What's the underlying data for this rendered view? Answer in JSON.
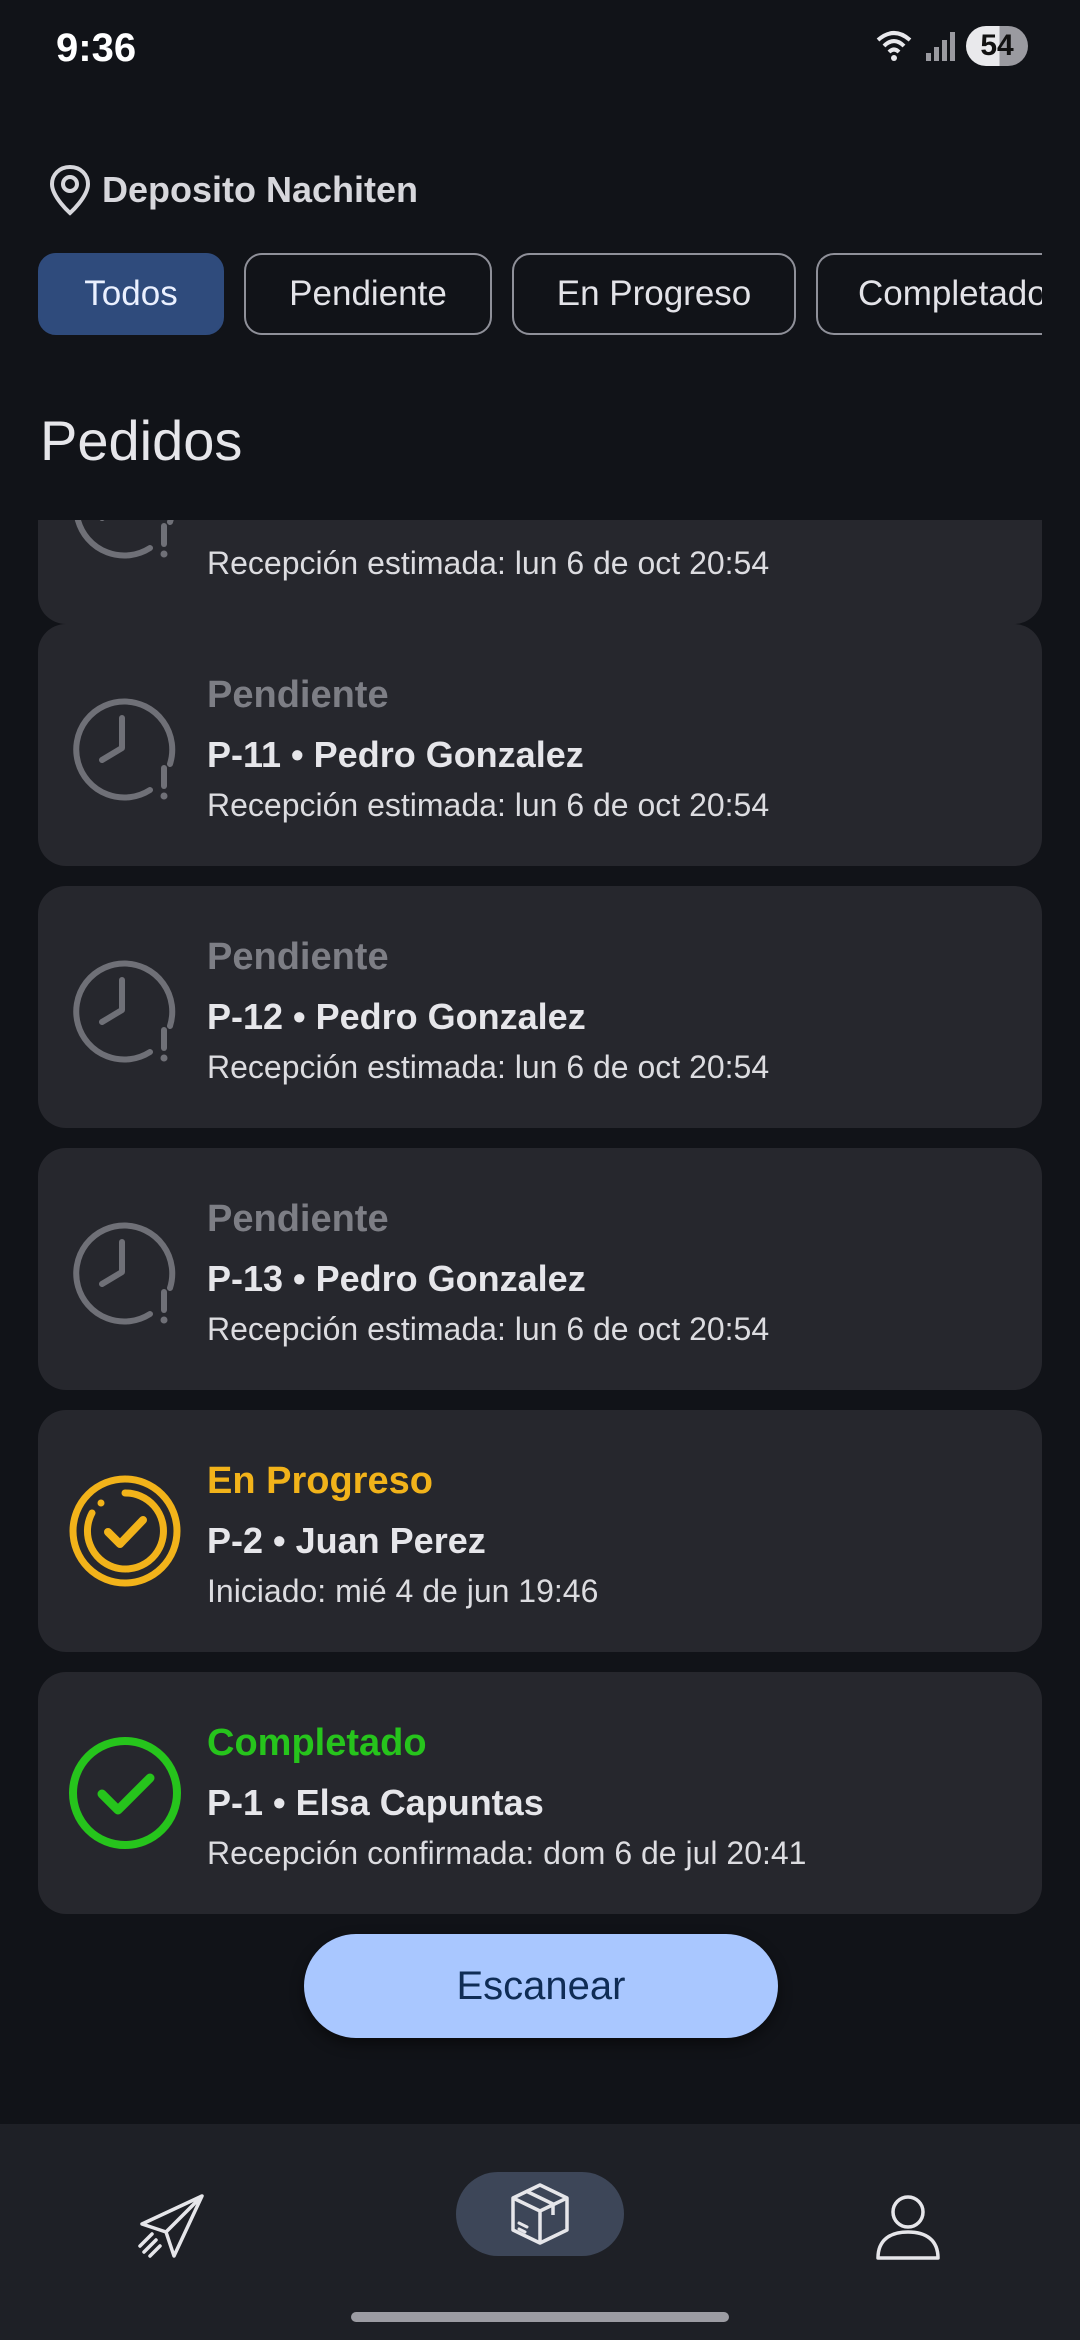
{
  "status_bar": {
    "time": "9:36",
    "battery": "54",
    "icons": [
      "wifi-icon",
      "signal-icon",
      "battery-icon"
    ]
  },
  "location": {
    "label": "Deposito Nachiten",
    "icon": "location-pin-icon"
  },
  "filters": {
    "todos": "Todos",
    "pendiente": "Pendiente",
    "en_progreso": "En Progreso",
    "completado": "Completado",
    "active": "Todos"
  },
  "section_title": "Pedidos",
  "orders": [
    {
      "status": "",
      "title": "",
      "subtitle": "Recepción estimada: lun 6 de oct 20:54",
      "icon": "clock-alert-icon"
    },
    {
      "status": "Pendiente",
      "title": "P-11 • Pedro Gonzalez",
      "subtitle": "Recepción estimada: lun 6 de oct 20:54",
      "icon": "clock-alert-icon"
    },
    {
      "status": "Pendiente",
      "title": "P-12 • Pedro Gonzalez",
      "subtitle": "Recepción estimada: lun 6 de oct 20:54",
      "icon": "clock-alert-icon"
    },
    {
      "status": "Pendiente",
      "title": "P-13 • Pedro Gonzalez",
      "subtitle": "Recepción estimada: lun 6 de oct 20:54",
      "icon": "clock-alert-icon"
    },
    {
      "status": "En Progreso",
      "title": "P-2 • Juan Perez",
      "subtitle": "Iniciado: mié 4 de jun 19:46",
      "icon": "in-progress-check-icon"
    },
    {
      "status": "Completado",
      "title": "P-1 • Elsa Capuntas",
      "subtitle": "Recepción confirmada: dom 6 de jul 20:41",
      "icon": "check-circle-icon"
    }
  ],
  "scan_button": "Escanear",
  "bottom_nav": {
    "items": [
      "send-icon",
      "package-icon",
      "profile-icon"
    ],
    "active": "package-icon"
  },
  "colors": {
    "pending": "#7d7e85",
    "in_progress": "#f2b31a",
    "completed": "#26c41c",
    "accent": "#a9c7ff"
  }
}
